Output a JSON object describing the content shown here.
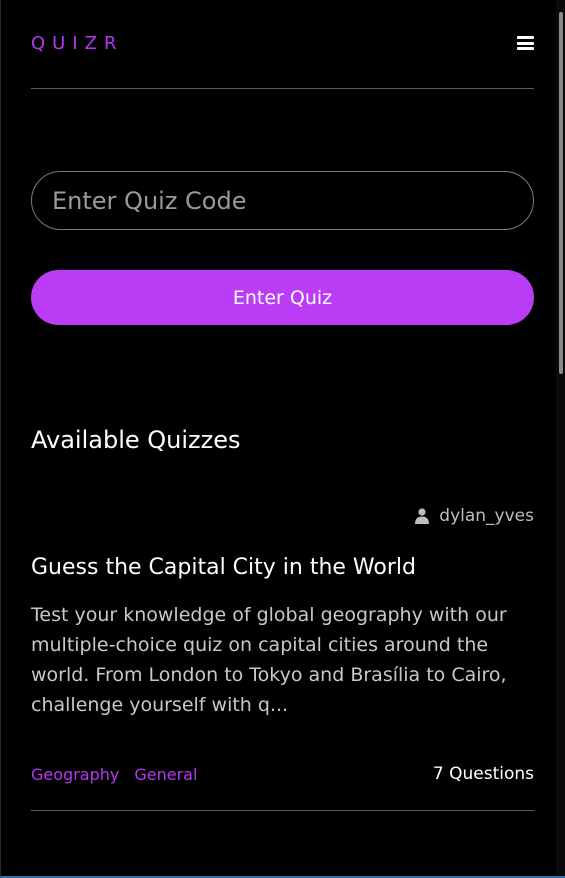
{
  "header": {
    "logo": "QUIZR",
    "menu_icon": "hamburger-menu-icon"
  },
  "join": {
    "placeholder": "Enter Quiz Code",
    "button_label": "Enter Quiz"
  },
  "section": {
    "title": "Available Quizzes"
  },
  "quizzes": [
    {
      "author": "dylan_yves",
      "author_icon": "user-icon",
      "title": "Guess the Capital City in the World",
      "description": "Test your knowledge of global geography with our multiple-choice quiz on capital cities around the world. From London to Tokyo and Brasília to Cairo, challenge yourself with q...",
      "tags": [
        "Geography",
        "General"
      ],
      "question_count": "7 Questions"
    }
  ],
  "colors": {
    "accent": "#bb3cf5",
    "background": "#000000",
    "text": "#ffffff"
  }
}
